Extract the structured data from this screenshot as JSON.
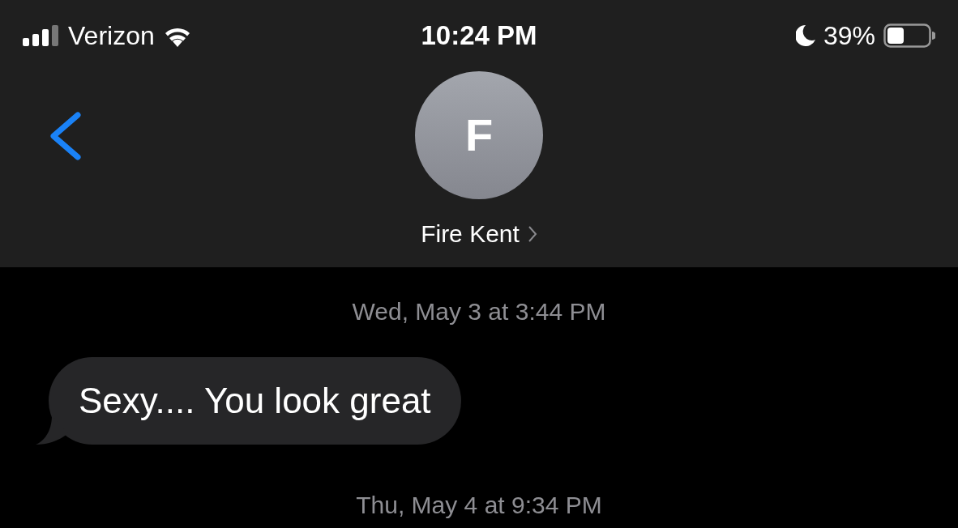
{
  "status_bar": {
    "carrier": "Verizon",
    "time": "10:24 PM",
    "battery": "39%"
  },
  "header": {
    "avatar_initial": "F",
    "contact_name": "Fire Kent"
  },
  "messages": [
    {
      "kind": "timestamp",
      "text": "Wed, May 3 at 3:44 PM"
    },
    {
      "kind": "incoming",
      "text": "Sexy.... You look great"
    },
    {
      "kind": "timestamp",
      "text": "Thu, May 4 at 9:34 PM"
    }
  ]
}
